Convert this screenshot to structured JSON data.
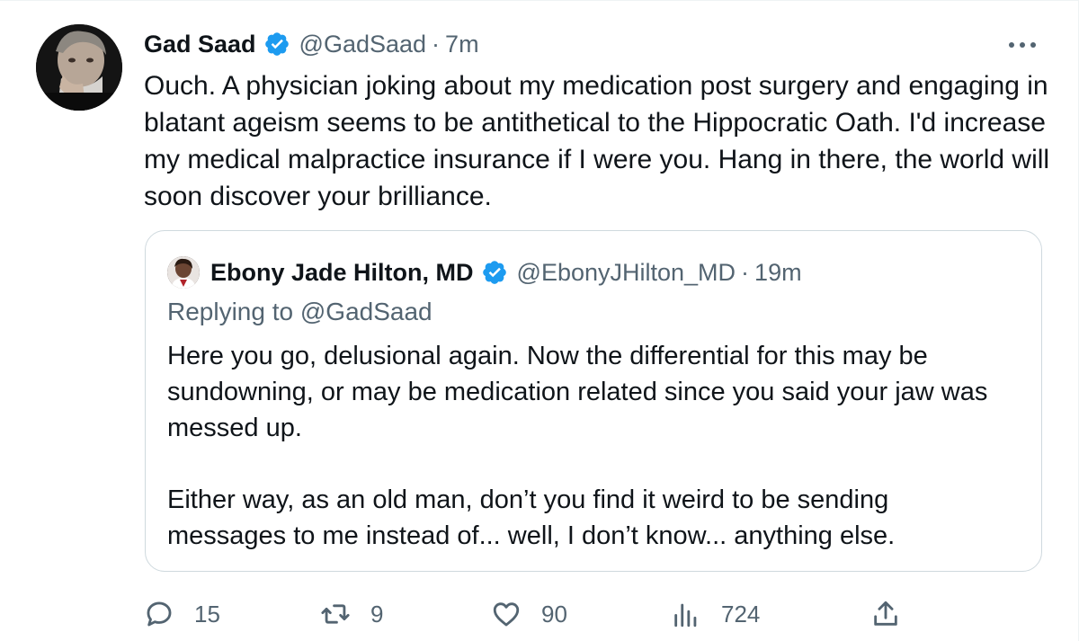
{
  "tweet": {
    "author": {
      "name": "Gad Saad",
      "handle": "@GadSaad",
      "separator": "·",
      "time": "7m"
    },
    "text": [
      "Ouch.  A physician joking about my medication post surgery and engaging in blatant ageism seems to be antithetical to the Hippocratic Oath. I'd increase my medical malpractice insurance if I were you.  Hang in there, the world will soon discover your brilliance."
    ],
    "more_icon": "more-horizontal-icon"
  },
  "quote": {
    "author": {
      "name": "Ebony Jade Hilton, MD",
      "handle": "@EbonyJHilton_MD",
      "separator": "·",
      "time": "19m"
    },
    "replying_to": "Replying to @GadSaad",
    "paragraphs": [
      "Here you go, delusional again. Now the differential for this may be sundowning, or may be medication related since you said your jaw was messed up.",
      "Either way, as an old man, don’t you find it weird to be sending messages to me instead of... well, I don’t know... anything else."
    ]
  },
  "actions": {
    "reply": {
      "icon": "reply-icon",
      "count": "15"
    },
    "retweet": {
      "icon": "retweet-icon",
      "count": "9"
    },
    "like": {
      "icon": "heart-icon",
      "count": "90"
    },
    "views": {
      "icon": "views-icon",
      "count": "724"
    },
    "share": {
      "icon": "share-icon"
    }
  },
  "colors": {
    "text": "#0f1419",
    "secondary": "#536471",
    "verified": "#1d9bf0",
    "border": "#cfd9de"
  }
}
